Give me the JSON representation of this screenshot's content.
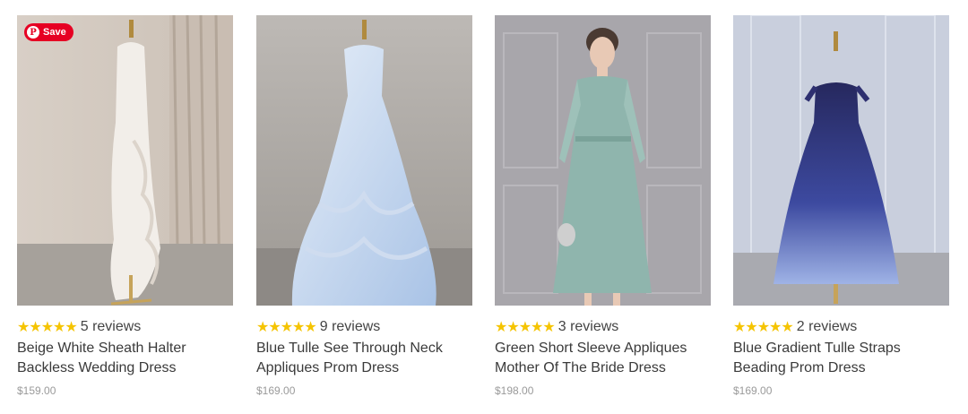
{
  "save_button": {
    "label": "Save",
    "icon": "pinterest-icon"
  },
  "colors": {
    "star": "#f5c400",
    "save": "#e60023",
    "price": "#9a9a9a"
  },
  "products": [
    {
      "stars": "★★★★★",
      "rating": 5,
      "reviews": "5 reviews",
      "title": "Beige White Sheath Halter Backless Wedding Dress",
      "price": "$159.00"
    },
    {
      "stars": "★★★★★",
      "rating": 5,
      "reviews": "9 reviews",
      "title": "Blue Tulle See Through Neck Appliques Prom Dress",
      "price": "$169.00"
    },
    {
      "stars": "★★★★★",
      "rating": 5,
      "reviews": "3 reviews",
      "title": "Green Short Sleeve Appliques Mother Of The Bride Dress",
      "price": "$198.00"
    },
    {
      "stars": "★★★★★",
      "rating": 5,
      "reviews": "2 reviews",
      "title": "Blue Gradient Tulle Straps Beading Prom Dress",
      "price": "$169.00"
    }
  ]
}
